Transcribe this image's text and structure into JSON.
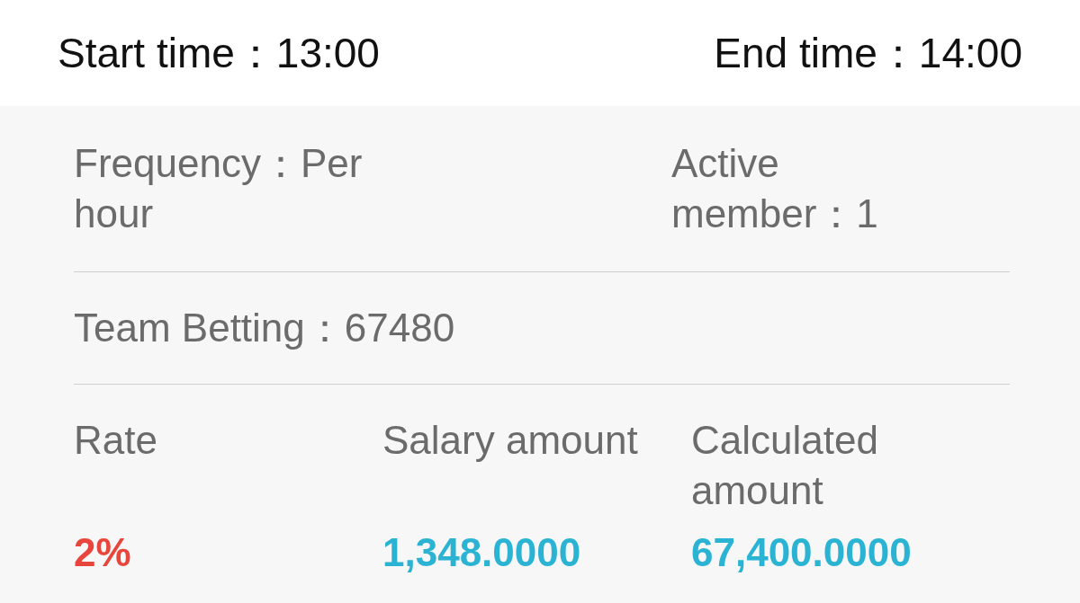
{
  "header": {
    "start_time": "Start time：13:00",
    "end_time": "End time：14:00"
  },
  "summary": {
    "frequency": "Frequency：Per hour",
    "active_member": "Active member：1",
    "team_betting": "Team Betting：67480"
  },
  "table": {
    "columns": [
      "Rate",
      "Salary amount",
      "Calculated amount"
    ],
    "rows": [
      {
        "cells": [
          {
            "text": "2%",
            "kind": "rate"
          },
          {
            "text": "1,348.0000",
            "kind": "amount"
          },
          {
            "text": "67,400.0000",
            "kind": "amount"
          }
        ]
      }
    ]
  }
}
